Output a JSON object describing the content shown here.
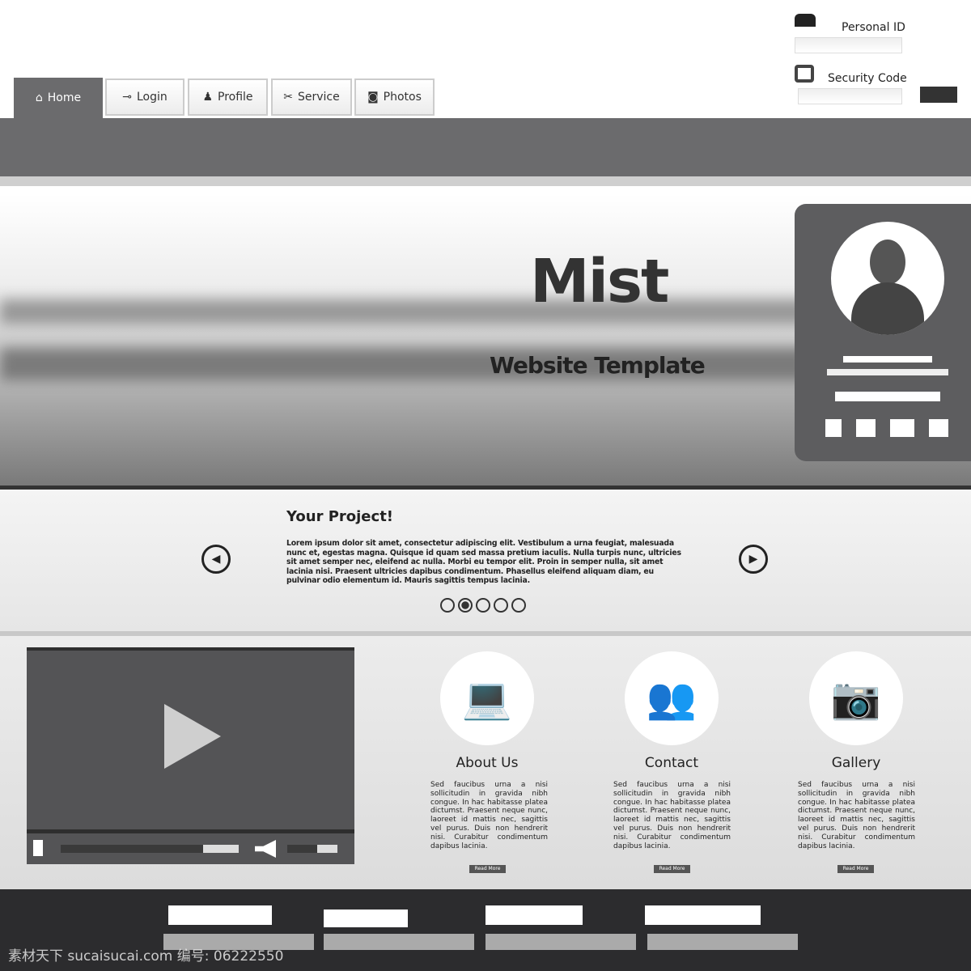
{
  "nav": {
    "tabs": [
      {
        "label": "Home",
        "icon": "home-icon"
      },
      {
        "label": "Login",
        "icon": "key-icon"
      },
      {
        "label": "Profile",
        "icon": "person-icon"
      },
      {
        "label": "Service",
        "icon": "tools-icon"
      },
      {
        "label": "Photos",
        "icon": "camera-icon"
      }
    ]
  },
  "login": {
    "personal_id_label": "Personal ID",
    "security_code_label": "Security Code",
    "personal_id_value": "",
    "security_code_value": ""
  },
  "hero": {
    "title": "Mist",
    "subtitle": "Website Template"
  },
  "project": {
    "title": "Your Project!",
    "body": "Lorem ipsum dolor sit amet, consectetur adipiscing elit. Vestibulum a urna feugiat, malesuada nunc et, egestas magna. Quisque id quam sed massa pretium iaculis. Nulla turpis nunc, ultricies sit amet semper nec, eleifend ac nulla. Morbi eu tempor elit. Proin in semper nulla, sit amet lacinia nisi. Praesent ultricies dapibus condimentum. Phasellus eleifend aliquam diam, eu pulvinar odio elementum id. Mauris sagittis tempus lacinia.",
    "active_slide": 2,
    "slide_count": 5
  },
  "video": {
    "progress": 0.8
  },
  "features": [
    {
      "title": "About Us",
      "icon": "laptop-icon",
      "text": "Sed faucibus urna a nisi sollicitudin in gravida nibh congue. In hac habitasse platea dictumst. Praesent neque nunc, laoreet id mattis nec, sagittis vel purus. Duis non hendrerit nisi. Curabitur condimentum dapibus lacinia.",
      "button": "Read More"
    },
    {
      "title": "Contact",
      "icon": "people-icon",
      "text": "Sed faucibus urna a nisi sollicitudin in gravida nibh congue. In hac habitasse platea dictumst. Praesent neque nunc, laoreet id mattis nec, sagittis vel purus. Duis non hendrerit nisi. Curabitur condimentum dapibus lacinia.",
      "button": "Read More"
    },
    {
      "title": "Gallery",
      "icon": "camera-icon",
      "text": "Sed faucibus urna a nisi sollicitudin in gravida nibh congue. In hac habitasse platea dictumst. Praesent neque nunc, laoreet id mattis nec, sagittis vel purus. Duis non hendrerit nisi. Curabitur condimentum dapibus lacinia.",
      "button": "Read More"
    }
  ],
  "watermark": "素材天下 sucaisucai.com 编号: 06222550"
}
